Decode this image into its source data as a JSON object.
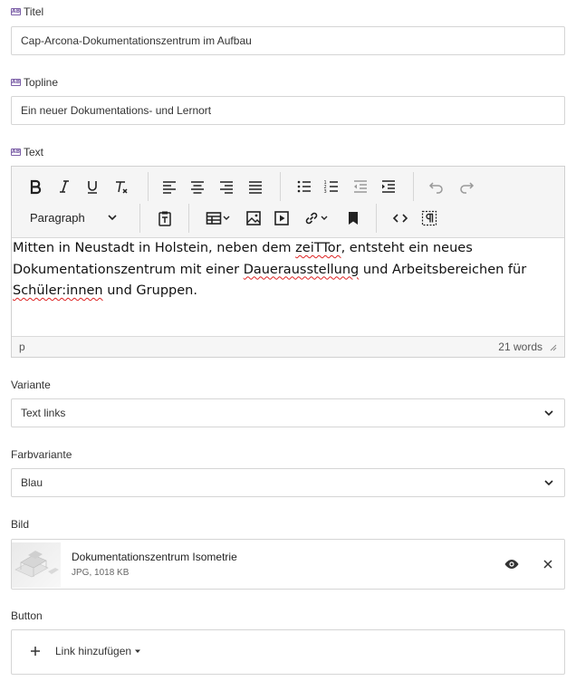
{
  "fields": {
    "titel": {
      "label": "Titel",
      "value": "Cap-Arcona-Dokumentationszentrum im Aufbau"
    },
    "topline": {
      "label": "Topline",
      "value": "Ein neuer Dokumentations- und Lernort"
    },
    "text": {
      "label": "Text",
      "paragraph_style": "Paragraph",
      "content_parts": [
        "Mitten in Neustadt in Holstein, neben dem ",
        "zeiTTor",
        ", entsteht ein neues Dokumentationszentrum mit einer ",
        "Dauerausstellung",
        " und Arbeitsbereichen für ",
        "Schüler:innen",
        " und Gruppen."
      ],
      "status_path": "p",
      "word_count": "21 words"
    },
    "variante": {
      "label": "Variante",
      "value": "Text links"
    },
    "farbvariante": {
      "label": "Farbvariante",
      "value": "Blau"
    },
    "bild": {
      "label": "Bild",
      "file_name": "Dokumentationszentrum Isometrie",
      "file_meta": "JPG, 1018 KB"
    },
    "button": {
      "label": "Button",
      "add_link": "Link hinzufügen"
    }
  },
  "lang_icon_text": "AB",
  "colors": {
    "translatable_icon": "#7b5ea7",
    "spellcheck_underline": "#dd2222"
  }
}
